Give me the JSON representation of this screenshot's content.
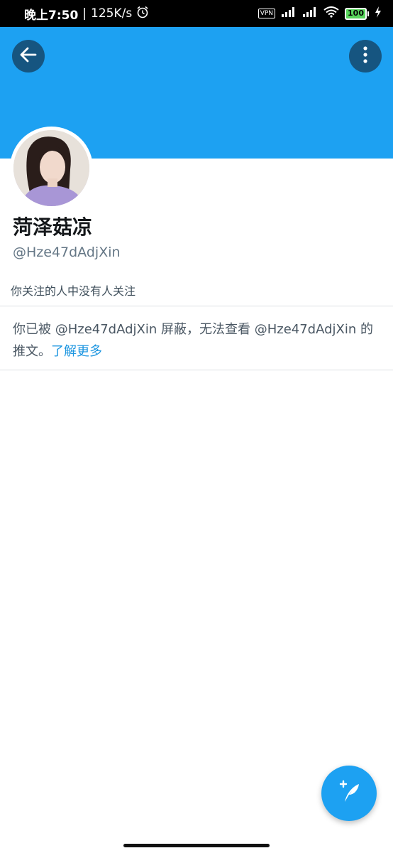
{
  "status_bar": {
    "time": "晚上7:50",
    "separator": "|",
    "network_speed": "125K/s",
    "vpn": "VPN",
    "battery": "100",
    "icons": [
      "alarm-icon",
      "signal-icon",
      "signal-icon",
      "wifi-icon",
      "battery-icon",
      "charging-icon"
    ]
  },
  "header": {
    "banner_color": "#1da1f2",
    "back_icon": "back-arrow-icon",
    "more_icon": "more-vertical-icon"
  },
  "profile": {
    "name": "菏泽菇凉",
    "handle": "@Hze47dAdjXin",
    "followers_note": "你关注的人中没有人关注"
  },
  "blocked_notice": {
    "message": "你已被 @Hze47dAdjXin 屏蔽，无法查看 @Hze47dAdjXin 的推文。",
    "link_text": "了解更多"
  },
  "fab": {
    "icon": "compose-tweet-icon",
    "color": "#1da1f2"
  }
}
